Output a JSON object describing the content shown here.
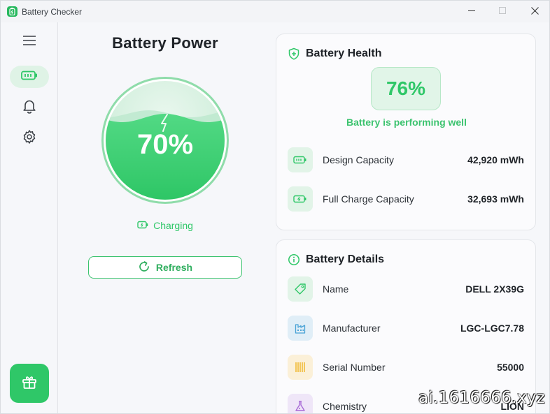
{
  "window": {
    "title": "Battery Checker",
    "minimize_icon": "minimize-icon",
    "maximize_icon": "maximize-icon",
    "close_icon": "close-icon"
  },
  "sidebar": {
    "items": [
      {
        "icon": "menu-icon",
        "active": false
      },
      {
        "icon": "battery-icon",
        "active": true
      },
      {
        "icon": "bell-icon",
        "active": false
      },
      {
        "icon": "gear-icon",
        "active": false
      }
    ],
    "gift_icon": "gift-icon"
  },
  "power": {
    "title": "Battery Power",
    "percent": "70%",
    "level": 0.7,
    "status": "Charging",
    "refresh_label": "Refresh"
  },
  "health": {
    "title": "Battery Health",
    "percent": "76%",
    "message": "Battery is performing well",
    "rows": [
      {
        "label": "Design Capacity",
        "value": "42,920 mWh",
        "icon": "battery-icon"
      },
      {
        "label": "Full Charge Capacity",
        "value": "32,693 mWh",
        "icon": "battery-charge-icon"
      }
    ]
  },
  "details": {
    "title": "Battery Details",
    "rows": [
      {
        "label": "Name",
        "value": "DELL 2X39G",
        "icon": "tag-icon"
      },
      {
        "label": "Manufacturer",
        "value": "LGC-LGC7.78",
        "icon": "factory-icon"
      },
      {
        "label": "Serial Number",
        "value": "55000",
        "icon": "barcode-icon"
      },
      {
        "label": "Chemistry",
        "value": "LION",
        "icon": "flask-icon"
      }
    ]
  },
  "colors": {
    "accent": "#2fc768",
    "accent_light": "#e1f5e8"
  },
  "watermark": "ai.1616666.xyz"
}
